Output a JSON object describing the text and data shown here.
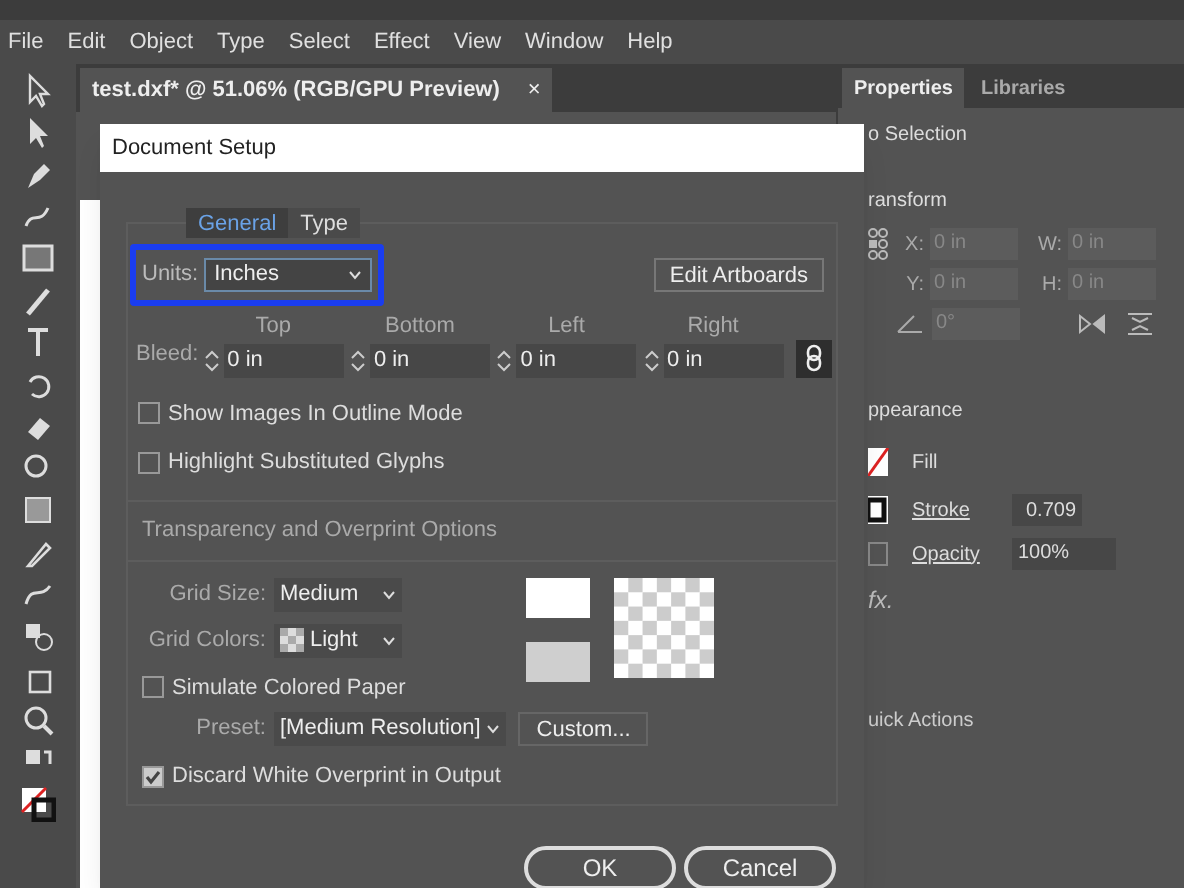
{
  "menu_bar": [
    "File",
    "Edit",
    "Object",
    "Type",
    "Select",
    "Effect",
    "View",
    "Window",
    "Help"
  ],
  "document_tab": {
    "title": "test.dxf* @ 51.06% (RGB/GPU Preview)",
    "close": "×"
  },
  "panel": {
    "tabs": [
      {
        "label": "Properties",
        "selected": true
      },
      {
        "label": "Libraries",
        "selected": false
      }
    ],
    "selection": "o Selection",
    "transform": {
      "title": "ransform",
      "disabled": true,
      "fields": [
        {
          "label": "X:",
          "value": "0 in"
        },
        {
          "label": "W:",
          "value": "0 in"
        },
        {
          "label": "Y:",
          "value": "0 in"
        },
        {
          "label": "H:",
          "value": "0 in"
        }
      ],
      "angle": "0°"
    },
    "appearance": {
      "title": "ppearance",
      "fill": "Fill",
      "stroke": {
        "label": "Stroke",
        "value": "0.709"
      },
      "opacity": {
        "label": "Opacity",
        "value": "100%"
      },
      "fx": "fx."
    },
    "quick_actions": "uick Actions"
  },
  "dialog": {
    "title": "Document Setup",
    "tabs": [
      {
        "label": "General",
        "selected": true
      },
      {
        "label": "Type",
        "selected": false
      }
    ],
    "units": {
      "label": "Units:",
      "value": "Inches",
      "highlighted": true
    },
    "edit_artboards": "Edit Artboards",
    "bleed": {
      "label": "Bleed:",
      "linked": true,
      "columns": [
        {
          "heading": "Top",
          "value": "0 in"
        },
        {
          "heading": "Bottom",
          "value": "0 in"
        },
        {
          "heading": "Left",
          "value": "0 in"
        },
        {
          "heading": "Right",
          "value": "0 in"
        }
      ]
    },
    "checkboxes": [
      {
        "label": "Show Images In Outline Mode",
        "checked": false
      },
      {
        "label": "Highlight Substituted Glyphs",
        "checked": false
      }
    ],
    "transparency": {
      "title": "Transparency and Overprint Options",
      "grid_size": {
        "label": "Grid Size:",
        "value": "Medium"
      },
      "grid_colors": {
        "label": "Grid Colors:",
        "value": "Light"
      },
      "simulate_paper": {
        "label": "Simulate Colored Paper",
        "checked": false
      },
      "preset": {
        "label": "Preset:",
        "value": "[Medium Resolution]"
      },
      "custom": "Custom...",
      "discard_white": {
        "label": "Discard White Overprint in Output",
        "checked": true
      }
    },
    "buttons": [
      "OK",
      "Cancel"
    ]
  }
}
